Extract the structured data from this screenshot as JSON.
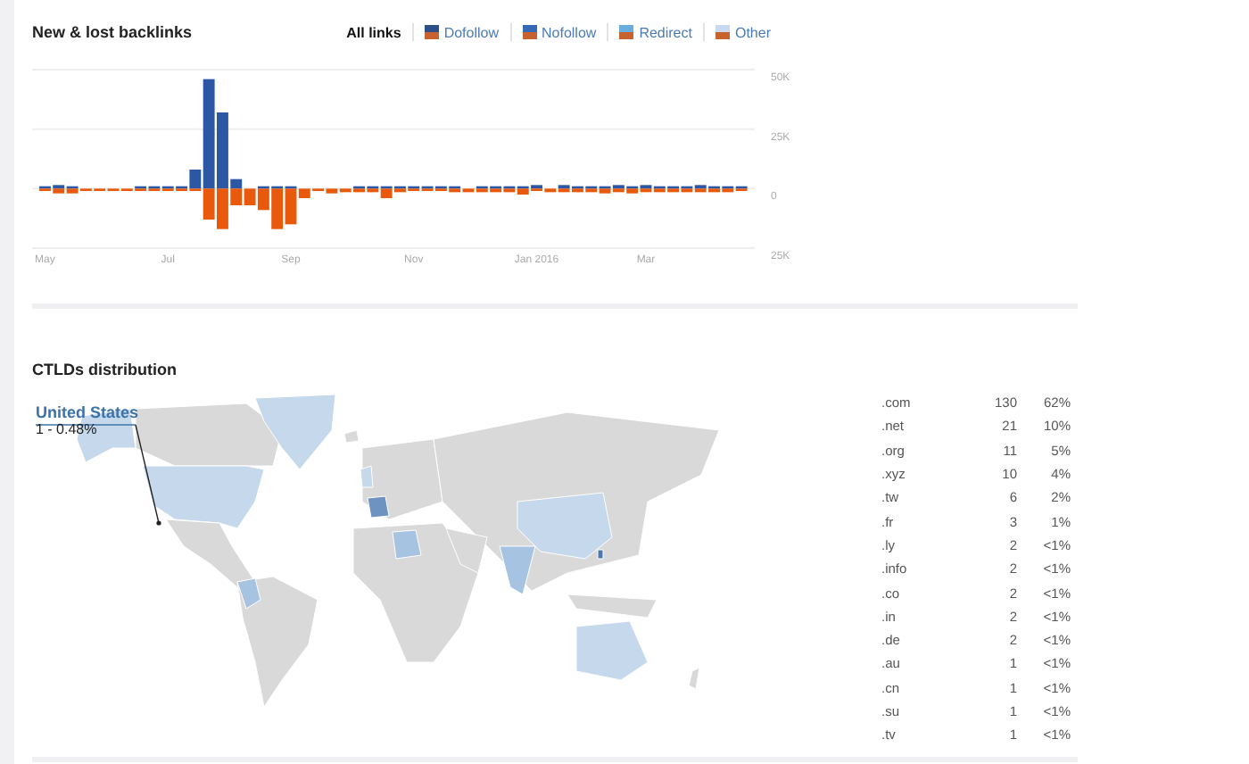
{
  "backlinks": {
    "title": "New & lost backlinks",
    "legend": [
      {
        "label": "All links",
        "selected": true
      },
      {
        "label": "Dofollow",
        "selected": false,
        "color": "#2b4f86"
      },
      {
        "label": "Nofollow",
        "selected": false,
        "color": "#3569b5"
      },
      {
        "label": "Redirect",
        "selected": false,
        "color": "#6aaee0"
      },
      {
        "label": "Other",
        "selected": false,
        "color": "#c9daf0"
      }
    ],
    "chart_data": {
      "type": "bar",
      "stacked": true,
      "ylim": [
        -25000,
        50000
      ],
      "categories": [
        "May",
        null,
        null,
        null,
        null,
        null,
        null,
        null,
        null,
        "Jul",
        null,
        null,
        null,
        null,
        null,
        null,
        null,
        null,
        "Sep",
        null,
        null,
        null,
        null,
        null,
        null,
        null,
        null,
        "Nov",
        null,
        null,
        null,
        null,
        null,
        null,
        null,
        null,
        "Jan 2016",
        null,
        null,
        null,
        null,
        null,
        null,
        null,
        "Mar",
        null,
        null,
        null,
        null,
        null,
        null,
        null
      ],
      "yticks": [
        {
          "value": 50000,
          "label": "50K"
        },
        {
          "value": 25000,
          "label": "25K"
        },
        {
          "value": 0,
          "label": "0"
        },
        {
          "value": -25000,
          "label": "25K"
        }
      ],
      "series": [
        {
          "color": "#2b57a5",
          "values": [
            1000,
            1500,
            1000,
            null,
            null,
            null,
            null,
            1000,
            1000,
            1000,
            1000,
            8000,
            46000,
            32000,
            4000,
            null,
            1000,
            1000,
            1000,
            null,
            null,
            null,
            null,
            1000,
            1000,
            1000,
            1000,
            1000,
            1000,
            1000,
            1000,
            null,
            1000,
            1000,
            1000,
            1000,
            1500,
            null,
            1500,
            1000,
            1000,
            1000,
            1500,
            1000,
            1500,
            1000,
            1000,
            1000,
            1500,
            1000,
            1000,
            1000
          ]
        },
        {
          "color": "#e8590c",
          "values": [
            -1000,
            -2000,
            -2000,
            -1000,
            -1000,
            -1000,
            -1000,
            -1000,
            -1000,
            -1000,
            -1000,
            -1000,
            -13000,
            -17000,
            -7000,
            -7000,
            -9000,
            -17000,
            -15000,
            -4000,
            -1000,
            -2000,
            -1500,
            -1500,
            -1500,
            -4000,
            -1500,
            -1000,
            -1000,
            -1000,
            -1500,
            -1500,
            -1500,
            -1500,
            -1500,
            -2500,
            -1000,
            -1500,
            -1500,
            -1500,
            -1500,
            -2000,
            -1500,
            -2000,
            -1500,
            -1500,
            -1500,
            -1500,
            -1500,
            -1500,
            -1500,
            -1000
          ]
        }
      ]
    }
  },
  "ctlds": {
    "title": "CTLDs distribution",
    "tooltip": {
      "country": "United States",
      "value": "1 - 0.48%"
    },
    "rows": [
      {
        "tld": ".com",
        "count": "130",
        "share": "62%"
      },
      {
        "tld": ".net",
        "count": "21",
        "share": "10%"
      },
      {
        "tld": ".org",
        "count": "11",
        "share": "5%"
      },
      {
        "tld": ".xyz",
        "count": "10",
        "share": "4%"
      },
      {
        "tld": ".tw",
        "count": "6",
        "share": "2%"
      },
      {
        "tld": ".fr",
        "count": "3",
        "share": "1%"
      },
      {
        "tld": ".ly",
        "count": "2",
        "share": "<1%"
      },
      {
        "tld": ".info",
        "count": "2",
        "share": "<1%"
      },
      {
        "tld": ".co",
        "count": "2",
        "share": "<1%"
      },
      {
        "tld": ".in",
        "count": "2",
        "share": "<1%"
      },
      {
        "tld": ".de",
        "count": "2",
        "share": "<1%"
      },
      {
        "tld": ".au",
        "count": "1",
        "share": "<1%"
      },
      {
        "tld": ".cn",
        "count": "1",
        "share": "<1%"
      },
      {
        "tld": ".su",
        "count": "1",
        "share": "<1%"
      },
      {
        "tld": ".tv",
        "count": "1",
        "share": "<1%"
      }
    ]
  }
}
